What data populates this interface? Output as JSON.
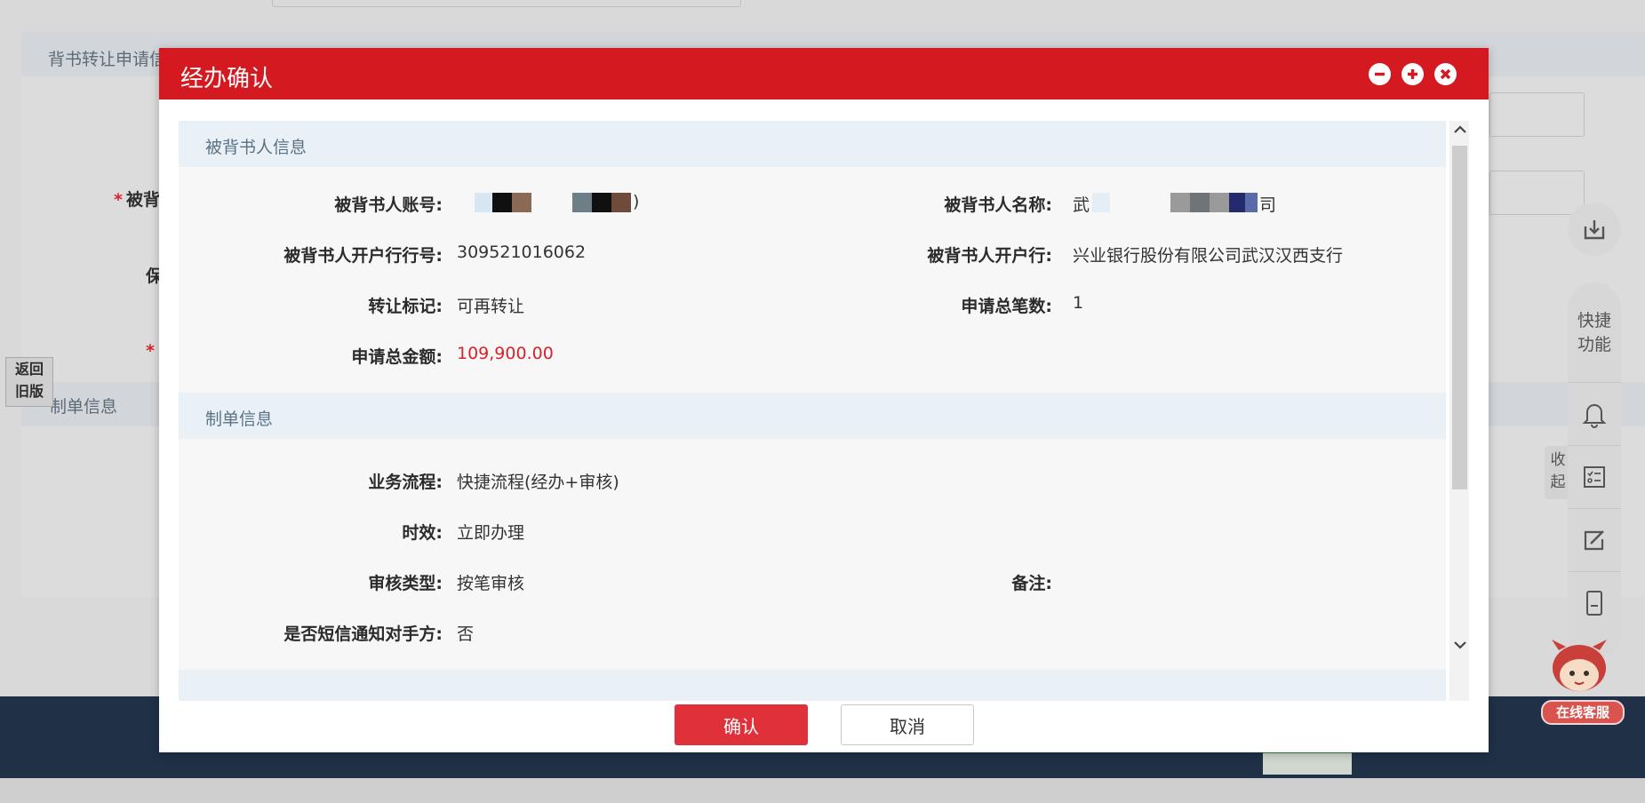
{
  "background": {
    "section1_title": "背书转让申请信息",
    "section2_title": "制单信息",
    "label_endorsee": "被背",
    "label_guarantee": "保",
    "back_to_old_line1": "返回",
    "back_to_old_line2": "旧版",
    "collapse_line1": "收",
    "collapse_line2": "起"
  },
  "side_toolbar": {
    "quick_line1": "快捷",
    "quick_line2": "功能",
    "online_service": "在线客服"
  },
  "modal": {
    "title": "经办确认",
    "section_endorsee": {
      "title": "被背书人信息",
      "account_label": "被背书人账号:",
      "account_value_suffix": ")",
      "name_label": "被背书人名称:",
      "name_value_prefix": "武",
      "name_value_suffix": "司",
      "bank_no_label": "被背书人开户行行号:",
      "bank_no_value": "309521016062",
      "bank_label": "被背书人开户行:",
      "bank_value": "兴业银行股份有限公司武汉汉西支行",
      "transfer_label": "转让标记:",
      "transfer_value": "可再转让",
      "count_label": "申请总笔数:",
      "count_value": "1",
      "amount_label": "申请总金额:",
      "amount_value": "109,900.00"
    },
    "section_maker": {
      "title": "制单信息",
      "process_label": "业务流程:",
      "process_value": "快捷流程(经办+审核)",
      "timing_label": "时效:",
      "timing_value": "立即办理",
      "review_label": "审核类型:",
      "review_value": "按笔审核",
      "remark_label": "备注:",
      "remark_value": "",
      "sms_label": "是否短信通知对手方:",
      "sms_value": "否"
    },
    "buttons": {
      "confirm": "确认",
      "cancel": "取消"
    }
  },
  "colors": {
    "header_red": "#d41a20",
    "confirm_red": "#e0313b",
    "amount_red": "#d6232b",
    "section_bg": "#e9f1f7",
    "footer_navy": "#1f3047"
  }
}
